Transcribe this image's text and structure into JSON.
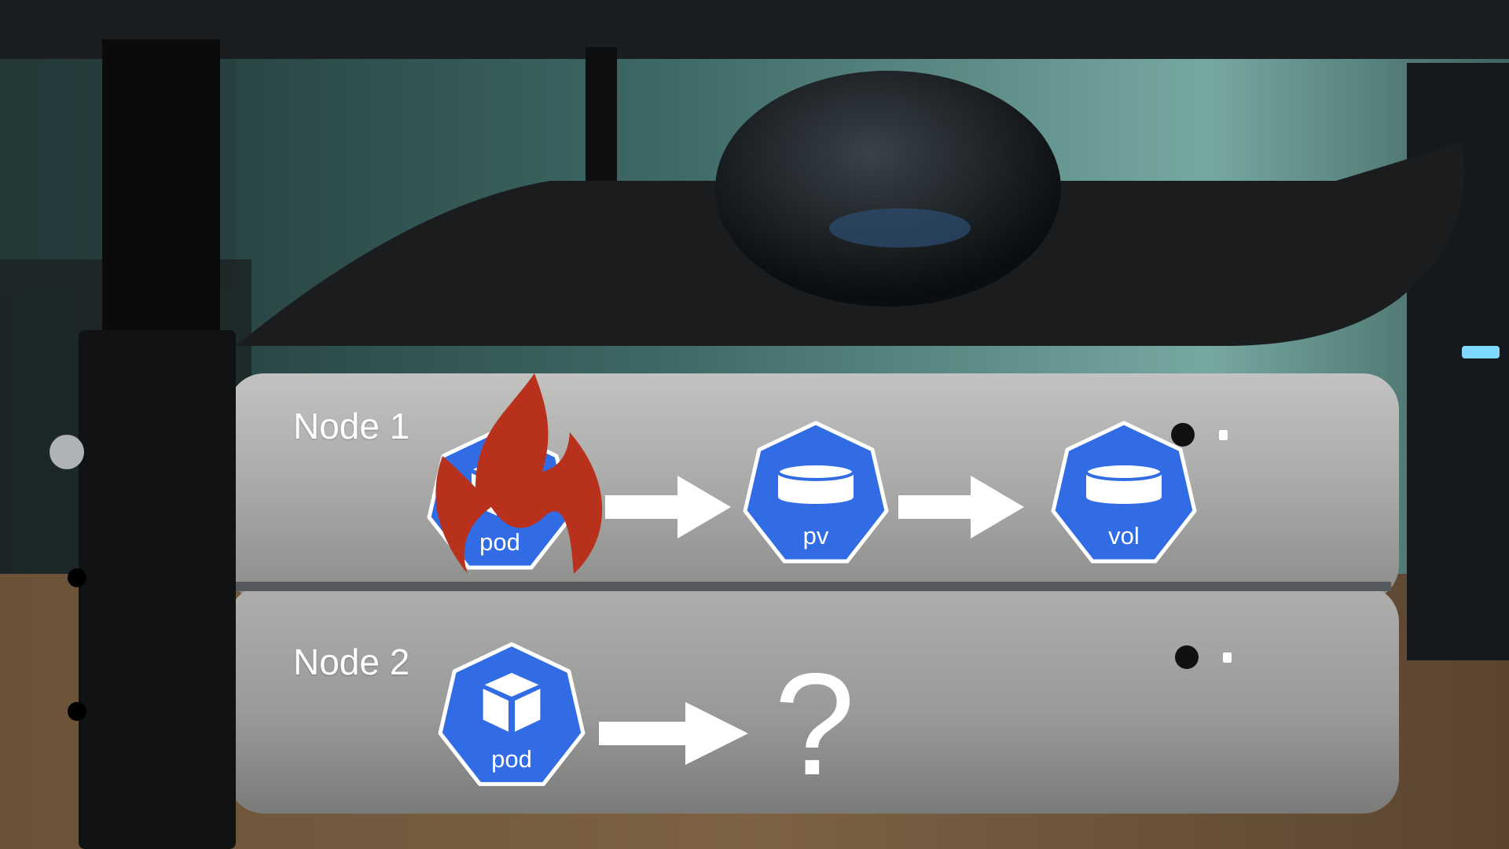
{
  "nodes": [
    {
      "label": "Node 1",
      "icons": [
        {
          "label": "pod",
          "icon": "pod-icon",
          "status": "failed"
        },
        {
          "label": "pv",
          "icon": "pv-icon"
        },
        {
          "label": "vol",
          "icon": "vol-icon"
        }
      ]
    },
    {
      "label": "Node 2",
      "icons": [
        {
          "label": "pod",
          "icon": "pod-icon"
        }
      ],
      "unknown_target": "?"
    }
  ],
  "colors": {
    "k8s_blue": "#326ce5",
    "fire": "#b8311d",
    "arrow": "#ffffff"
  }
}
